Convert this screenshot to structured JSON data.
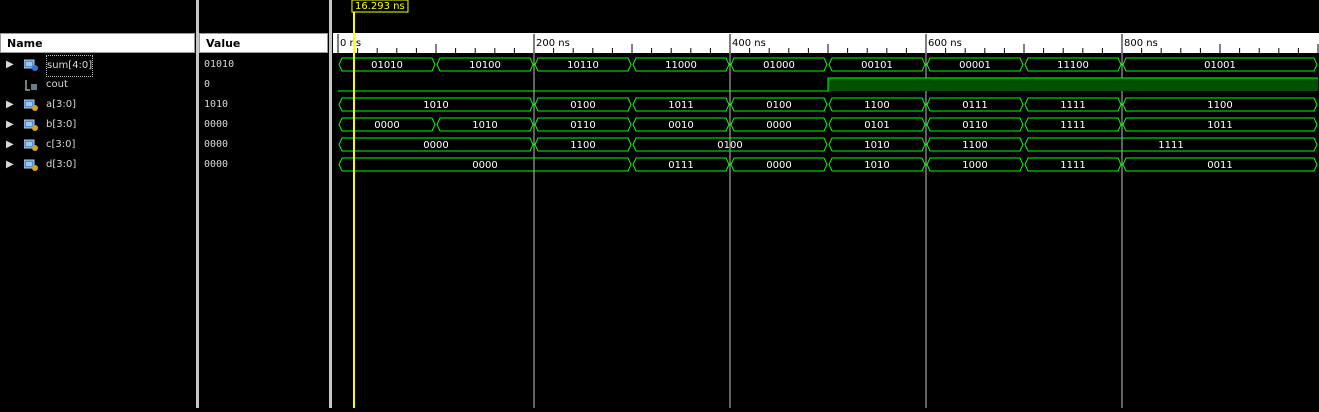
{
  "headers": {
    "name": "Name",
    "value": "Value"
  },
  "cursor": {
    "label": "16.293 ns",
    "time_ns": 16.293
  },
  "timeline": {
    "range_ns": [
      0,
      1000
    ],
    "major_ticks": [
      {
        "t": 0,
        "label": "0 ns"
      },
      {
        "t": 200,
        "label": "200 ns"
      },
      {
        "t": 400,
        "label": "400 ns"
      },
      {
        "t": 600,
        "label": "600 ns"
      },
      {
        "t": 800,
        "label": "800 ns"
      }
    ]
  },
  "signals": [
    {
      "name": "sum[4:0]",
      "value": "01010",
      "type": "bus",
      "icon": "bus-output-icon",
      "segments": [
        [
          0,
          100,
          "01010"
        ],
        [
          100,
          200,
          "10100"
        ],
        [
          200,
          300,
          "10110"
        ],
        [
          300,
          400,
          "11000"
        ],
        [
          400,
          500,
          "01000"
        ],
        [
          500,
          600,
          "00101"
        ],
        [
          600,
          700,
          "00001"
        ],
        [
          700,
          800,
          "11100"
        ],
        [
          800,
          1000,
          "01001"
        ]
      ]
    },
    {
      "name": "cout",
      "value": "0",
      "type": "bit",
      "icon": "bit-output-icon",
      "transitions": [
        [
          0,
          0
        ],
        [
          500,
          1
        ]
      ]
    },
    {
      "name": "a[3:0]",
      "value": "1010",
      "type": "bus",
      "icon": "bus-input-icon",
      "segments": [
        [
          0,
          200,
          "1010"
        ],
        [
          200,
          300,
          "0100"
        ],
        [
          300,
          400,
          "1011"
        ],
        [
          400,
          500,
          "0100"
        ],
        [
          500,
          600,
          "1100"
        ],
        [
          600,
          700,
          "0111"
        ],
        [
          700,
          800,
          "1111"
        ],
        [
          800,
          1000,
          "1100"
        ]
      ]
    },
    {
      "name": "b[3:0]",
      "value": "0000",
      "type": "bus",
      "icon": "bus-input-icon",
      "segments": [
        [
          0,
          100,
          "0000"
        ],
        [
          100,
          200,
          "1010"
        ],
        [
          200,
          300,
          "0110"
        ],
        [
          300,
          400,
          "0010"
        ],
        [
          400,
          500,
          "0000"
        ],
        [
          500,
          600,
          "0101"
        ],
        [
          600,
          700,
          "0110"
        ],
        [
          700,
          800,
          "1111"
        ],
        [
          800,
          1000,
          "1011"
        ]
      ]
    },
    {
      "name": "c[3:0]",
      "value": "0000",
      "type": "bus",
      "icon": "bus-input-icon",
      "segments": [
        [
          0,
          200,
          "0000"
        ],
        [
          200,
          300,
          "1100"
        ],
        [
          300,
          500,
          "0100"
        ],
        [
          500,
          600,
          "1010"
        ],
        [
          600,
          700,
          "1100"
        ],
        [
          700,
          1000,
          "1111"
        ]
      ]
    },
    {
      "name": "d[3:0]",
      "value": "0000",
      "type": "bus",
      "icon": "bus-input-icon",
      "segments": [
        [
          0,
          300,
          "0000"
        ],
        [
          300,
          400,
          "0111"
        ],
        [
          400,
          500,
          "0000"
        ],
        [
          500,
          600,
          "1010"
        ],
        [
          600,
          700,
          "1000"
        ],
        [
          700,
          800,
          "1111"
        ],
        [
          800,
          1000,
          "0011"
        ]
      ]
    }
  ],
  "colors": {
    "wave": "#00ff00",
    "cursor": "#ffff00",
    "bit_high_fill": "#005000",
    "grid": "#c0c0c0"
  }
}
